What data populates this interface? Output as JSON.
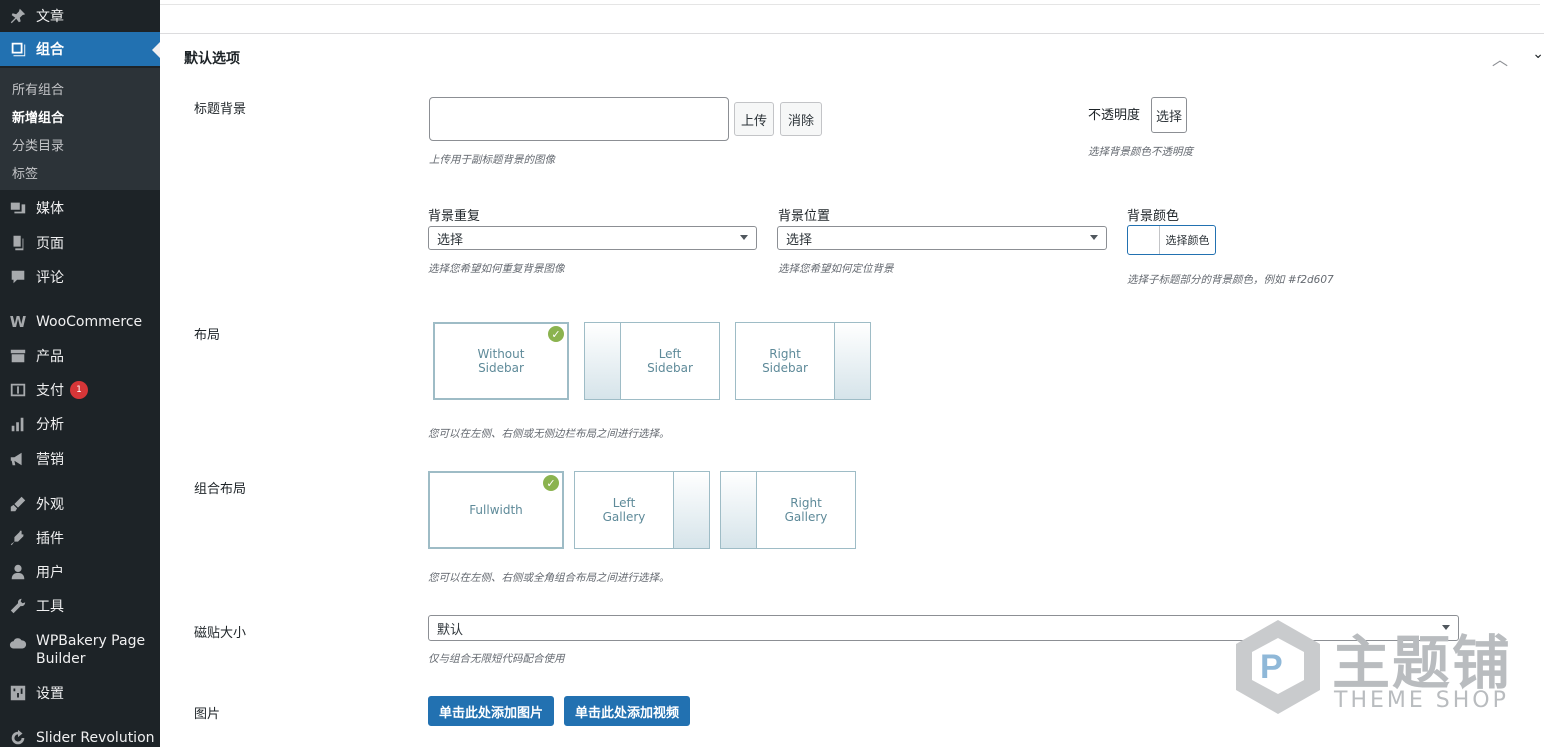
{
  "sidebar": {
    "items": [
      {
        "label": "文章",
        "icon": "pin-icon"
      },
      {
        "label": "组合",
        "icon": "portfolio-icon"
      },
      {
        "label": "媒体",
        "icon": "media-icon"
      },
      {
        "label": "页面",
        "icon": "page-icon"
      },
      {
        "label": "评论",
        "icon": "comment-icon"
      },
      {
        "label": "WooCommerce",
        "icon": "woocommerce-icon"
      },
      {
        "label": "产品",
        "icon": "archive-icon"
      },
      {
        "label": "支付",
        "icon": "payment-icon",
        "badge": "1"
      },
      {
        "label": "分析",
        "icon": "chart-icon"
      },
      {
        "label": "营销",
        "icon": "megaphone-icon"
      },
      {
        "label": "外观",
        "icon": "brush-icon"
      },
      {
        "label": "插件",
        "icon": "plugin-icon"
      },
      {
        "label": "用户",
        "icon": "user-icon"
      },
      {
        "label": "工具",
        "icon": "wrench-icon"
      },
      {
        "label": "WPBakery Page\nBuilder",
        "icon": "cloud-icon"
      },
      {
        "label": "设置",
        "icon": "settings-icon"
      },
      {
        "label": "Slider Revolution",
        "icon": "refresh-icon"
      }
    ],
    "submenu": [
      "所有组合",
      "新增组合",
      "分类目录",
      "标签"
    ],
    "active_color": "#2271b1"
  },
  "panel": {
    "title": "默认选项",
    "collapse_icon": "chevron-up-icon"
  },
  "title_bg": {
    "label": "标题背景",
    "upload_button": "上传",
    "clear_button": "消除",
    "hint": "上传用于副标题背景的图像",
    "opacity_label": "不透明度",
    "opacity_select": "选择",
    "opacity_hint": "选择背景颜色不透明度"
  },
  "bg_repeat": {
    "label": "背景重复",
    "value": "选择",
    "hint": "选择您希望如何重复背景图像"
  },
  "bg_position": {
    "label": "背景位置",
    "value": "选择",
    "hint": "选择您希望如何定位背景"
  },
  "bg_color": {
    "label": "背景颜色",
    "button": "选择颜色",
    "hint": "选择子标题部分的背景颜色，例如 #f2d607"
  },
  "layout": {
    "label": "布局",
    "options": [
      "Without\nSidebar",
      "Left\nSidebar",
      "Right\nSidebar"
    ],
    "selected": 0,
    "hint": "您可以在左侧、右侧或无侧边栏布局之间进行选择。"
  },
  "portfolio_layout": {
    "label": "组合布局",
    "options": [
      "Fullwidth",
      "Left\nGallery",
      "Right\nGallery"
    ],
    "selected": 0,
    "hint": "您可以在左侧、右侧或全角组合布局之间进行选择。"
  },
  "tile_size": {
    "label": "磁贴大小",
    "value": "默认",
    "hint": "仅与组合无限短代码配合使用"
  },
  "images": {
    "label": "图片",
    "add_image": "单击此处添加图片",
    "add_video": "单击此处添加视频"
  },
  "watermark": {
    "text": "主题铺",
    "sub": "THEME SHOP"
  }
}
